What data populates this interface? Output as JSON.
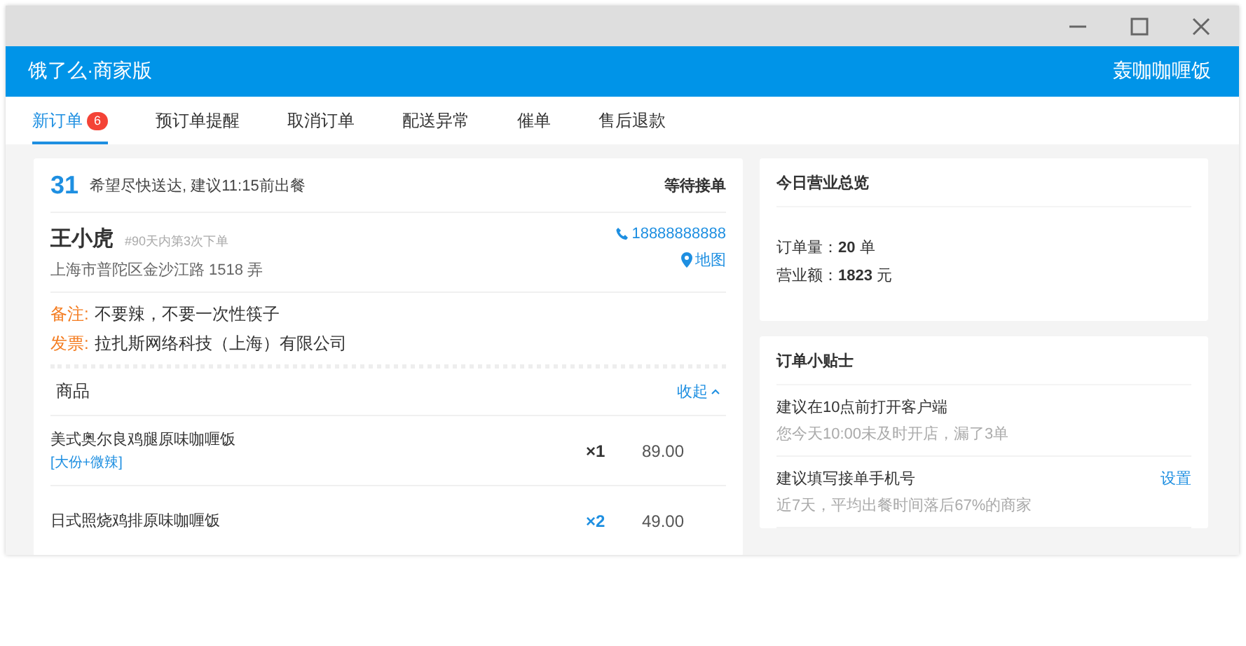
{
  "app_bar": {
    "title": "饿了么·商家版",
    "shop_name": "轰咖咖喱饭"
  },
  "tabs": [
    {
      "label": "新订单",
      "badge": "6",
      "selected": true
    },
    {
      "label": "预订单提醒",
      "selected": false
    },
    {
      "label": "取消订单",
      "selected": false
    },
    {
      "label": "配送异常",
      "selected": false
    },
    {
      "label": "催单",
      "selected": false
    },
    {
      "label": "售后退款",
      "selected": false
    }
  ],
  "order": {
    "number": "31",
    "delivery_note": "希望尽快送达, 建议11:15前出餐",
    "status": "等待接单",
    "customer_name": "王小虎",
    "order_history": "#90天内第3次下单",
    "address": "上海市普陀区金沙江路 1518 弄",
    "phone": "18888888888",
    "map_link": "地图",
    "remarks": [
      {
        "label": "备注:",
        "text": "不要辣，不要一次性筷子"
      },
      {
        "label": "发票:",
        "text": "拉扎斯网络科技（上海）有限公司"
      }
    ],
    "items_heading": "商品",
    "collapse_link": "收起",
    "items": [
      {
        "name": "美式奥尔良鸡腿原味咖喱饭",
        "spec": "[大份+微辣]",
        "quantity": "×1",
        "highlighted": false,
        "price": "89.00"
      },
      {
        "name": "日式照烧鸡排原味咖喱饭",
        "quantity": "×2",
        "highlighted": true,
        "price": "49.00"
      }
    ]
  },
  "summary": {
    "title": "今日营业总览",
    "lines": [
      "订单量：**20** 单",
      "营业额：**1823** 元"
    ]
  },
  "tips": {
    "title": "订单小贴士",
    "items": [
      {
        "title": "建议在10点前打开客户端",
        "detail": "您今天10:00未及时开店，漏了3单"
      },
      {
        "title": "建议填写接单手机号",
        "action": "设置",
        "detail": "近7天，平均出餐时间落后67%的商家"
      }
    ]
  }
}
